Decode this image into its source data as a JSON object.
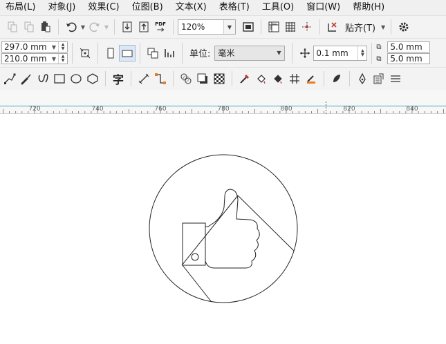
{
  "menu": [
    "布局(L)",
    "对象(J)",
    "效果(C)",
    "位图(B)",
    "文本(X)",
    "表格(T)",
    "工具(O)",
    "窗口(W)",
    "帮助(H)"
  ],
  "toolbar_standard": {
    "pdf_label": "PDF",
    "zoom_value": "120%",
    "snap_label": "贴齐(T)"
  },
  "property_bar": {
    "page_width": "297.0 mm",
    "page_height": "210.0 mm",
    "units_label": "单位:",
    "units_value": "毫米",
    "nudge_value": "0.1 mm",
    "duplicate_x": "5.0 mm",
    "duplicate_y": "5.0 mm"
  },
  "toolbox": {
    "text_tool_glyph": "字"
  },
  "ruler": {
    "ticks": [
      "720",
      "740",
      "760",
      "780",
      "800",
      "820",
      "840"
    ]
  }
}
